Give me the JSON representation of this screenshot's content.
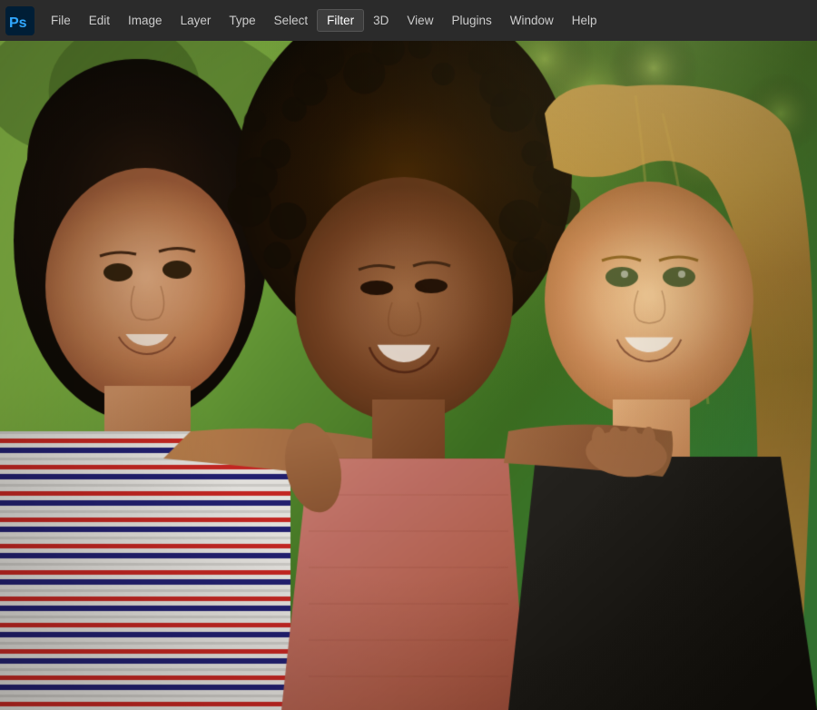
{
  "menubar": {
    "items": [
      {
        "id": "file",
        "label": "File",
        "active": false
      },
      {
        "id": "edit",
        "label": "Edit",
        "active": false
      },
      {
        "id": "image",
        "label": "Image",
        "active": false
      },
      {
        "id": "layer",
        "label": "Layer",
        "active": false
      },
      {
        "id": "type",
        "label": "Type",
        "active": false
      },
      {
        "id": "select",
        "label": "Select",
        "active": false
      },
      {
        "id": "filter",
        "label": "Filter",
        "active": true
      },
      {
        "id": "3d",
        "label": "3D",
        "active": false
      },
      {
        "id": "view",
        "label": "View",
        "active": false
      },
      {
        "id": "plugins",
        "label": "Plugins",
        "active": false
      },
      {
        "id": "window",
        "label": "Window",
        "active": false
      },
      {
        "id": "help",
        "label": "Help",
        "active": false
      }
    ]
  },
  "app": {
    "title": "Adobe Photoshop",
    "logo_color": "#31a8ff"
  },
  "canvas": {
    "description": "Photo of three young women smiling outdoors with green background"
  }
}
